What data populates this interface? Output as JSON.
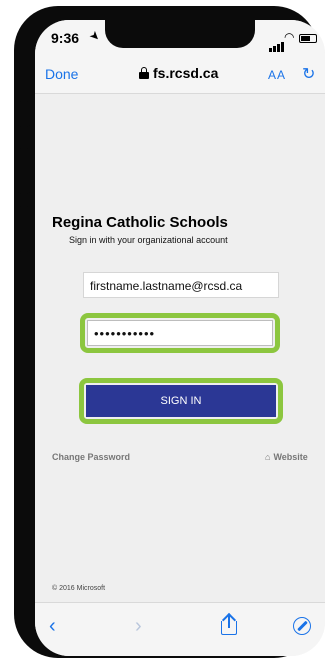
{
  "status_bar": {
    "time": "9:36"
  },
  "address_bar": {
    "done_label": "Done",
    "host": "fs.rcsd.ca",
    "text_size_label": "AA"
  },
  "login": {
    "org_name": "Regina Catholic Schools",
    "subtitle": "Sign in with your organizational account",
    "email_value": "firstname.lastname@rcsd.ca",
    "password_value": "•••••••••••",
    "sign_in_label": "SIGN IN",
    "change_password_label": "Change Password",
    "website_label": "Website",
    "copyright": "© 2016 Microsoft"
  },
  "colors": {
    "accent": "#1a73e8",
    "sign_in_button": "#2b3795",
    "highlight": "#8cc63f"
  },
  "icons": {
    "location": "location-arrow-icon",
    "lock": "lock-icon",
    "reload": "reload-icon",
    "back": "chevron-left-icon",
    "forward": "chevron-right-icon",
    "share": "share-icon",
    "compass": "compass-icon",
    "home": "home-icon"
  }
}
